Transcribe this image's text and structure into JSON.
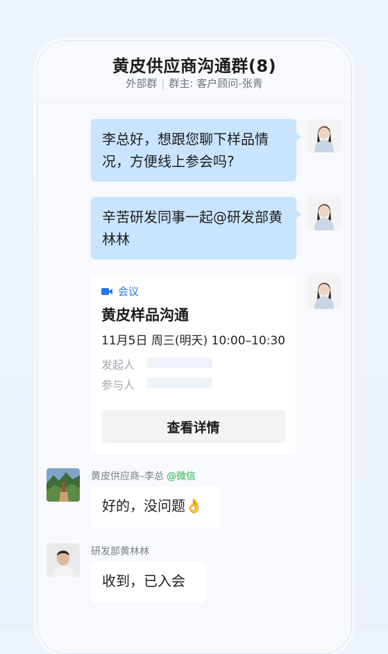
{
  "header": {
    "title": "黄皮供应商沟通群(8)",
    "group_type": "外部群",
    "owner": "群主: 客户顾问-张青"
  },
  "messages": [
    {
      "text": "李总好，想跟您聊下样品情况，方便线上参会吗?"
    },
    {
      "text": "辛苦研发同事一起@研发部黄林林"
    }
  ],
  "meeting_card": {
    "tag": "会议",
    "title": "黄皮样品沟通",
    "time": "11月5日 周三(明天) 10:00–10:30",
    "organizer_label": "发起人",
    "attendees_label": "参与人",
    "button_label": "查看详情"
  },
  "replies": [
    {
      "sender": "黄皮供应商–李总",
      "source": "@微信",
      "text": "好的，没问题👌"
    },
    {
      "sender": "研发部黄林林",
      "text": "收到，已入会"
    }
  ],
  "colors": {
    "accent_blue": "#2776e6",
    "wechat_green": "#2bb24c",
    "my_bubble": "#c9e4ff"
  }
}
